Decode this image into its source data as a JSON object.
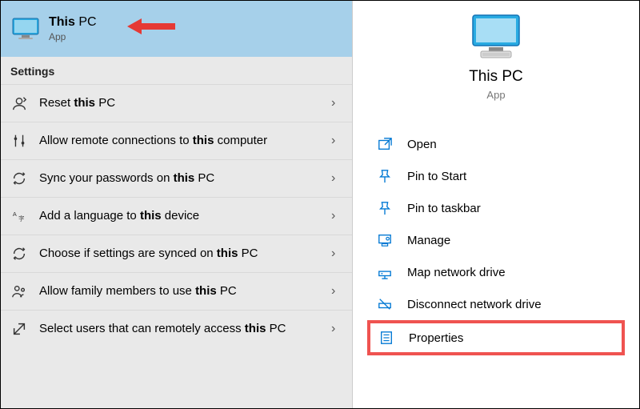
{
  "topResult": {
    "title_pre": "This",
    "title_post": " PC",
    "subtitle": "App"
  },
  "settingsHeader": "Settings",
  "settings": [
    {
      "pre": "Reset ",
      "bold": "this",
      "post": " PC"
    },
    {
      "pre": "Allow remote connections to ",
      "bold": "this",
      "post": " computer"
    },
    {
      "pre": "Sync your passwords on ",
      "bold": "this",
      "post": " PC"
    },
    {
      "pre": "Add a language to ",
      "bold": "this",
      "post": " device"
    },
    {
      "pre": "Choose if settings are synced on ",
      "bold": "this",
      "post": " PC"
    },
    {
      "pre": "Allow family members to use ",
      "bold": "this",
      "post": " PC"
    },
    {
      "pre": "Select users that can remotely access ",
      "bold": "this",
      "post": " PC"
    }
  ],
  "rightPane": {
    "title": "This PC",
    "subtitle": "App"
  },
  "actions": {
    "open": "Open",
    "pinStart": "Pin to Start",
    "pinTaskbar": "Pin to taskbar",
    "manage": "Manage",
    "mapDrive": "Map network drive",
    "disconnectDrive": "Disconnect network drive",
    "properties": "Properties"
  }
}
